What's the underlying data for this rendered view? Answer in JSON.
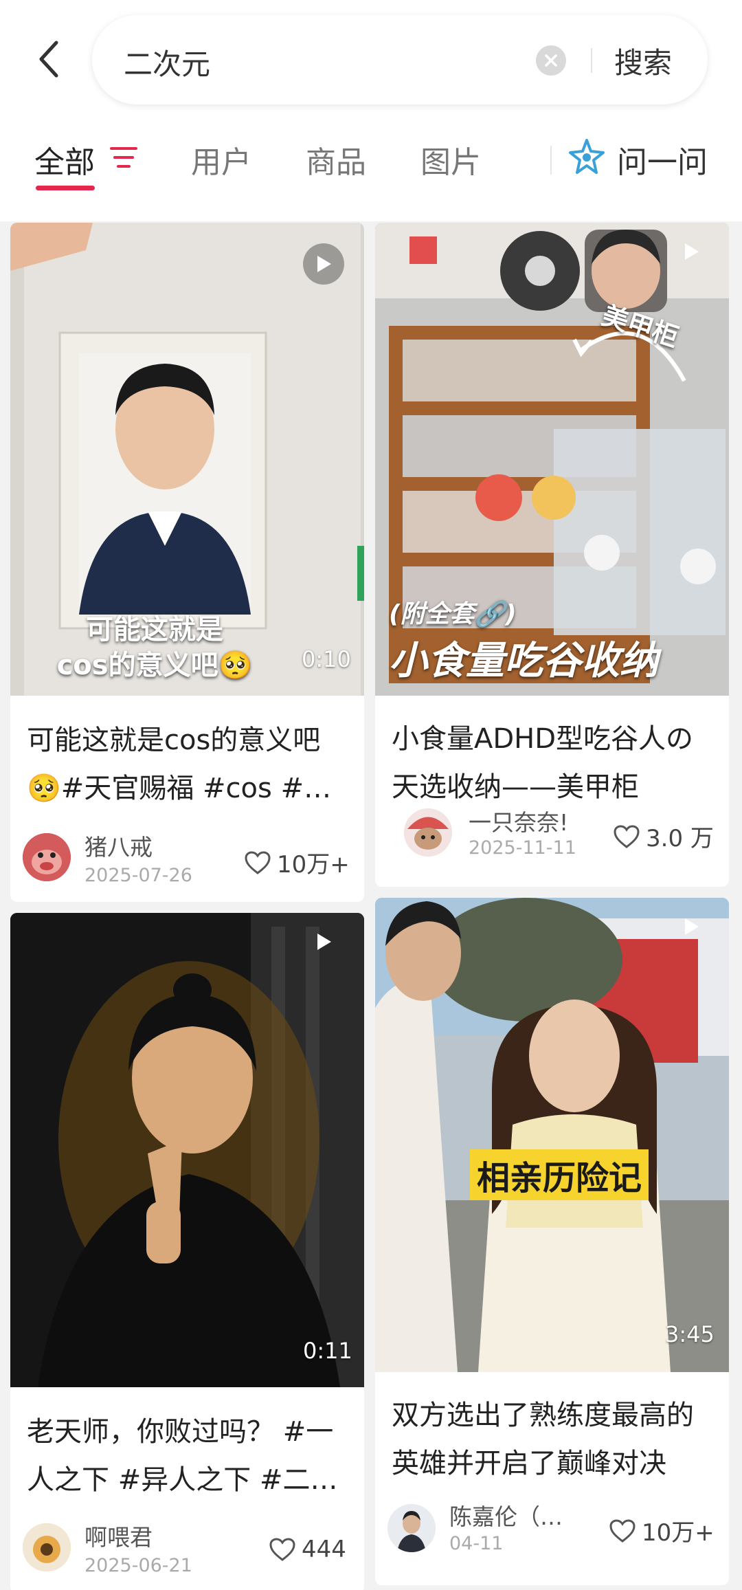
{
  "search": {
    "query": "二次元",
    "button": "搜索"
  },
  "tabs": [
    {
      "label": "全部"
    },
    {
      "label": "用户"
    },
    {
      "label": "商品"
    },
    {
      "label": "图片"
    }
  ],
  "ask": {
    "label": "问一问"
  },
  "cards": [
    {
      "overlay_line1": "可能这就是",
      "overlay_line2": "cos的意义吧🥺",
      "duration": "0:10",
      "title": "可能这就是cos的意义吧🥺#天官赐福 #cos #二次元",
      "author": "猪八戒",
      "date": "2025-07-26",
      "likes": "10万+"
    },
    {
      "overlay_tag": "美甲柜",
      "overlay_sub": "(附全套🔗)",
      "overlay_main": "小食量吃谷收纳",
      "title": "小食量ADHD型吃谷人の天选收纳——美甲柜",
      "author": "一只奈奈!",
      "date": "2025-11-11",
      "likes": "3.0 万"
    },
    {
      "duration": "0:11",
      "title": "老天师，你败过吗？ #一人之下 #异人之下 #二次元",
      "author": "啊喂君",
      "date": "2025-06-21",
      "likes": "444"
    },
    {
      "overlay_main": "相亲历险记",
      "duration": "3:45",
      "title": "双方选出了熟练度最高的英雄并开启了巅峰对决",
      "author": "陈嘉伦（…",
      "date": "04-11",
      "likes": "10万+"
    }
  ],
  "colors": {
    "accent": "#e3284d",
    "ask_icon": "#3aa0d8"
  }
}
